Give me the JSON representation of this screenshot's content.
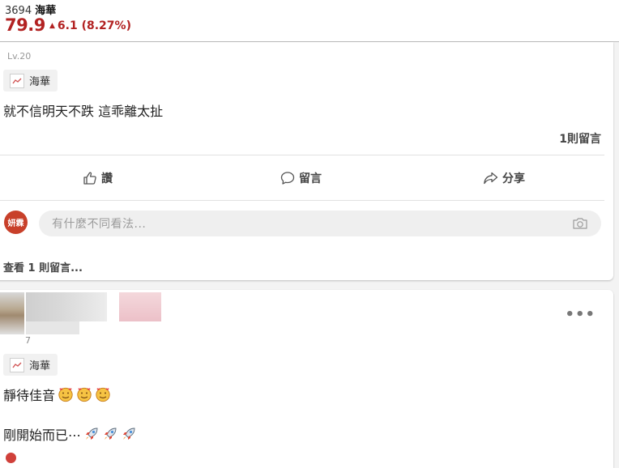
{
  "header": {
    "code": "3694",
    "name": "海華",
    "price": "79.9",
    "change": "6.1 (8.27%)",
    "up_color": "#b22222"
  },
  "post1": {
    "level": "Lv.20",
    "tag": "海華",
    "text": "就不信明天不跌 這乖離太扯",
    "comment_count": "1則留言",
    "actions": {
      "like": "讚",
      "comment": "留言",
      "share": "分享"
    },
    "avatar_text": "妍霖",
    "comment_placeholder": "有什麼不同看法...",
    "view_comments": "查看 1 則留言..."
  },
  "post2": {
    "level_suffix": "7",
    "tag": "海華",
    "line1": "靜待佳音",
    "line2": "剛開始而已⋯",
    "emoji1": "smiling-face-with-hearts-icon",
    "emoji2": "rocket-icon"
  }
}
